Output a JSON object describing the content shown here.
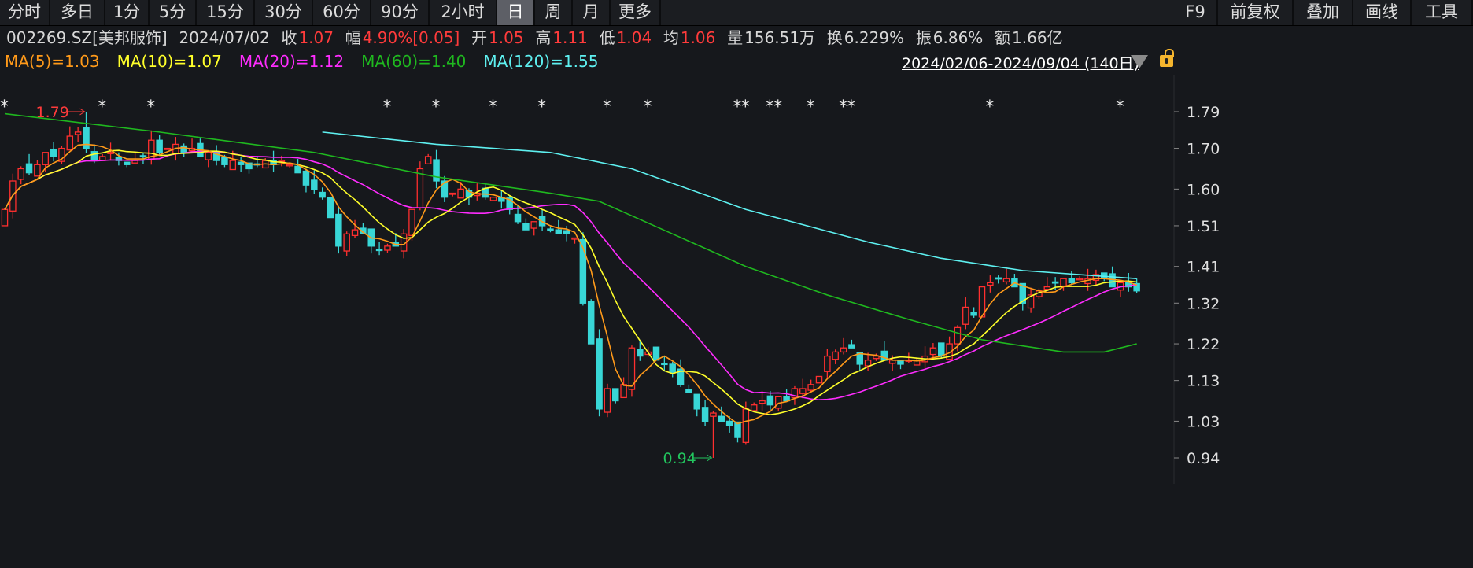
{
  "toolbar": {
    "periods": [
      "分时",
      "多日",
      "1分",
      "5分",
      "15分",
      "30分",
      "60分",
      "90分",
      "2小时",
      "日",
      "周",
      "月",
      "更多"
    ],
    "active": "日",
    "right": [
      "F9",
      "前复权",
      "叠加",
      "画线",
      "工具"
    ]
  },
  "info": {
    "code": "002269.SZ[美邦服饰]",
    "date": "2024/07/02",
    "close_label": "收",
    "close": "1.07",
    "change_label": "幅",
    "change": "4.90%[0.05]",
    "open_label": "开",
    "open": "1.05",
    "high_label": "高",
    "high": "1.11",
    "low_label": "低",
    "low": "1.04",
    "avg_label": "均",
    "avg": "1.06",
    "vol_label": "量",
    "vol": "156.51万",
    "turnover_label": "换",
    "turnover": "6.229%",
    "amplitude_label": "振",
    "amplitude": "6.86%",
    "amount_label": "额",
    "amount": "1.66亿"
  },
  "ma_legend": [
    {
      "label": "MA(5)=1.03",
      "color": "#ff9a1a"
    },
    {
      "label": "MA(10)=1.07",
      "color": "#ffff2a"
    },
    {
      "label": "MA(20)=1.12",
      "color": "#ff2cff"
    },
    {
      "label": "MA(60)=1.40",
      "color": "#1fb81f"
    },
    {
      "label": "MA(120)=1.55",
      "color": "#5ef0f0"
    }
  ],
  "range_label": "2024/02/06-2024/09/04 (140日)",
  "chart_data": {
    "type": "candlestick",
    "ylim": [
      0.94,
      1.79
    ],
    "yticks": [
      "1.79",
      "1.70",
      "1.60",
      "1.51",
      "1.41",
      "1.32",
      "1.22",
      "1.13",
      "1.03",
      "0.94"
    ],
    "colors": {
      "up": "#ff2f2f",
      "down": "#38d6d6",
      "ma5": "#ff9a1a",
      "ma10": "#ffff2a",
      "ma20": "#ff2cff",
      "ma60": "#1fb81f",
      "ma120": "#5ef0f0"
    },
    "closes": [
      1.55,
      1.62,
      1.65,
      1.64,
      1.66,
      1.69,
      1.68,
      1.7,
      1.73,
      1.74,
      1.7,
      1.67,
      1.68,
      1.69,
      1.67,
      1.66,
      1.67,
      1.68,
      1.72,
      1.69,
      1.7,
      1.71,
      1.69,
      1.7,
      1.68,
      1.69,
      1.67,
      1.66,
      1.67,
      1.66,
      1.65,
      1.66,
      1.67,
      1.66,
      1.67,
      1.66,
      1.64,
      1.61,
      1.6,
      1.58,
      1.53,
      1.46,
      1.49,
      1.5,
      1.49,
      1.46,
      1.45,
      1.46,
      1.46,
      1.49,
      1.55,
      1.65,
      1.68,
      1.62,
      1.58,
      1.59,
      1.6,
      1.58,
      1.59,
      1.58,
      1.58,
      1.57,
      1.55,
      1.52,
      1.5,
      1.52,
      1.51,
      1.5,
      1.49,
      1.49,
      1.48,
      1.32,
      1.22,
      1.06,
      1.11,
      1.08,
      1.12,
      1.21,
      1.19,
      1.2,
      1.18,
      1.17,
      1.15,
      1.12,
      1.1,
      1.06,
      1.03,
      1.05,
      1.03,
      1.02,
      0.99,
      1.06,
      1.07,
      1.08,
      1.07,
      1.09,
      1.08,
      1.11,
      1.11,
      1.12,
      1.14,
      1.19,
      1.2,
      1.21,
      1.21,
      1.17,
      1.18,
      1.19,
      1.18,
      1.18,
      1.17,
      1.18,
      1.18,
      1.19,
      1.21,
      1.19,
      1.22,
      1.26,
      1.31,
      1.29,
      1.36,
      1.37,
      1.38,
      1.38,
      1.36,
      1.32,
      1.34,
      1.35,
      1.36,
      1.37,
      1.38,
      1.37,
      1.38,
      1.38,
      1.39,
      1.38,
      1.36,
      1.37,
      1.36,
      1.35
    ],
    "ma60_points": [
      [
        0,
        1.785
      ],
      [
        19,
        1.74
      ],
      [
        38,
        1.69
      ],
      [
        53,
        1.63
      ],
      [
        67,
        1.59
      ],
      [
        73,
        1.57
      ],
      [
        82,
        1.49
      ],
      [
        91,
        1.41
      ],
      [
        101,
        1.34
      ],
      [
        111,
        1.28
      ],
      [
        120,
        1.23
      ],
      [
        130,
        1.2
      ],
      [
        135,
        1.2
      ],
      [
        139,
        1.22
      ]
    ],
    "ma120_points": [
      [
        39,
        1.74
      ],
      [
        53,
        1.71
      ],
      [
        67,
        1.69
      ],
      [
        77,
        1.65
      ],
      [
        91,
        1.55
      ],
      [
        106,
        1.47
      ],
      [
        115,
        1.43
      ],
      [
        125,
        1.4
      ],
      [
        139,
        1.38
      ]
    ],
    "event_markers": [
      0,
      12,
      18,
      47,
      53,
      60,
      66,
      74,
      79,
      90,
      91,
      94,
      95,
      99,
      103,
      104,
      121,
      137
    ],
    "high_mark": {
      "index": 10,
      "value": 1.79,
      "label": "1.79"
    },
    "low_mark": {
      "index": 87,
      "value": 0.94,
      "label": "0.94"
    }
  }
}
